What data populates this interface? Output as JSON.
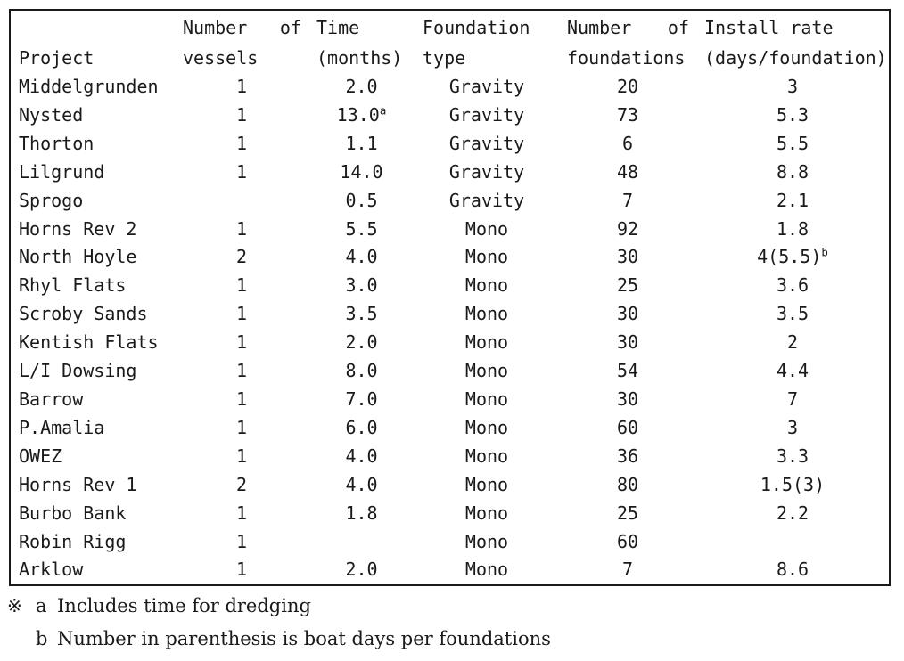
{
  "table": {
    "columns": [
      {
        "key": "project",
        "line1": "Project",
        "line2": "",
        "justify1": false,
        "justify2": false,
        "single": true
      },
      {
        "key": "vessels",
        "line1": "Number of",
        "line2": "vessels",
        "justify1": true,
        "justify2": false,
        "single": false
      },
      {
        "key": "time",
        "line1": "Time",
        "line2": "(months)",
        "justify1": false,
        "justify2": false,
        "single": false
      },
      {
        "key": "foundation",
        "line1": "Foundation",
        "line2": "type",
        "justify1": false,
        "justify2": false,
        "single": false
      },
      {
        "key": "foundations",
        "line1": "Number of",
        "line2": "foundations",
        "justify1": true,
        "justify2": false,
        "single": false
      },
      {
        "key": "rate",
        "line1": "Install rate",
        "line2": "(days/foundation)",
        "justify1": false,
        "justify2": false,
        "single": false
      }
    ],
    "rows": [
      {
        "project": "Middelgrunden",
        "vessels": "1",
        "time": "2.0",
        "time_sup": "",
        "foundation": "Gravity",
        "foundations": "20",
        "rate": "3",
        "rate_sup": ""
      },
      {
        "project": "Nysted",
        "vessels": "1",
        "time": "13.0",
        "time_sup": "a",
        "foundation": "Gravity",
        "foundations": "73",
        "rate": "5.3",
        "rate_sup": ""
      },
      {
        "project": "Thorton",
        "vessels": "1",
        "time": "1.1",
        "time_sup": "",
        "foundation": "Gravity",
        "foundations": "6",
        "rate": "5.5",
        "rate_sup": ""
      },
      {
        "project": "Lilgrund",
        "vessels": "1",
        "time": "14.0",
        "time_sup": "",
        "foundation": "Gravity",
        "foundations": "48",
        "rate": "8.8",
        "rate_sup": ""
      },
      {
        "project": "Sprogo",
        "vessels": "",
        "time": "0.5",
        "time_sup": "",
        "foundation": "Gravity",
        "foundations": "7",
        "rate": "2.1",
        "rate_sup": ""
      },
      {
        "project": "Horns Rev 2",
        "vessels": "1",
        "time": "5.5",
        "time_sup": "",
        "foundation": "Mono",
        "foundations": "92",
        "rate": "1.8",
        "rate_sup": ""
      },
      {
        "project": "North Hoyle",
        "vessels": "2",
        "time": "4.0",
        "time_sup": "",
        "foundation": "Mono",
        "foundations": "30",
        "rate": "4(5.5)",
        "rate_sup": "b"
      },
      {
        "project": "Rhyl Flats",
        "vessels": "1",
        "time": "3.0",
        "time_sup": "",
        "foundation": "Mono",
        "foundations": "25",
        "rate": "3.6",
        "rate_sup": ""
      },
      {
        "project": "Scroby Sands",
        "vessels": "1",
        "time": "3.5",
        "time_sup": "",
        "foundation": "Mono",
        "foundations": "30",
        "rate": "3.5",
        "rate_sup": ""
      },
      {
        "project": "Kentish Flats",
        "vessels": "1",
        "time": "2.0",
        "time_sup": "",
        "foundation": "Mono",
        "foundations": "30",
        "rate": "2",
        "rate_sup": ""
      },
      {
        "project": "L/I Dowsing",
        "vessels": "1",
        "time": "8.0",
        "time_sup": "",
        "foundation": "Mono",
        "foundations": "54",
        "rate": "4.4",
        "rate_sup": ""
      },
      {
        "project": "Barrow",
        "vessels": "1",
        "time": "7.0",
        "time_sup": "",
        "foundation": "Mono",
        "foundations": "30",
        "rate": "7",
        "rate_sup": ""
      },
      {
        "project": "P.Amalia",
        "vessels": "1",
        "time": "6.0",
        "time_sup": "",
        "foundation": "Mono",
        "foundations": "60",
        "rate": "3",
        "rate_sup": ""
      },
      {
        "project": "OWEZ",
        "vessels": "1",
        "time": "4.0",
        "time_sup": "",
        "foundation": "Mono",
        "foundations": "36",
        "rate": "3.3",
        "rate_sup": ""
      },
      {
        "project": "Horns Rev 1",
        "vessels": "2",
        "time": "4.0",
        "time_sup": "",
        "foundation": "Mono",
        "foundations": "80",
        "rate": "1.5(3)",
        "rate_sup": ""
      },
      {
        "project": "Burbo Bank",
        "vessels": "1",
        "time": "1.8",
        "time_sup": "",
        "foundation": "Mono",
        "foundations": "25",
        "rate": "2.2",
        "rate_sup": ""
      },
      {
        "project": "Robin Rigg",
        "vessels": "1",
        "time": "",
        "time_sup": "",
        "foundation": "Mono",
        "foundations": "60",
        "rate": "",
        "rate_sup": ""
      },
      {
        "project": "Arklow",
        "vessels": "1",
        "time": "2.0",
        "time_sup": "",
        "foundation": "Mono",
        "foundations": "7",
        "rate": "8.6",
        "rate_sup": ""
      }
    ]
  },
  "footnotes": {
    "mark": "※",
    "items": [
      {
        "label": "a",
        "text": "Includes time for dredging"
      },
      {
        "label": "b",
        "text": "Number in parenthesis is boat days per foundations"
      }
    ]
  },
  "colors": {
    "text": "#1a1a1a",
    "rule": "#1a1a1a",
    "background": "#ffffff"
  }
}
